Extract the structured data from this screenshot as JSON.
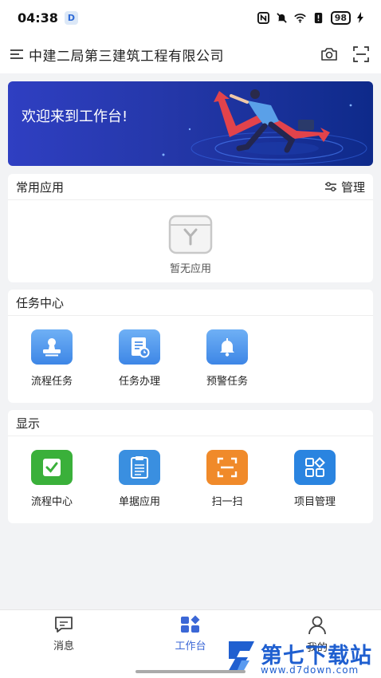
{
  "status_bar": {
    "time": "04:38",
    "app_badge": "D",
    "battery": "98"
  },
  "header": {
    "company_name": "中建二局第三建筑工程有限公司",
    "icons": [
      "menu-icon",
      "camera-icon",
      "scan-icon"
    ]
  },
  "banner": {
    "text": "欢迎来到工作台!"
  },
  "common_apps": {
    "title": "常用应用",
    "manage_label": "管理",
    "empty_text": "暂无应用"
  },
  "task_center": {
    "title": "任务中心",
    "items": [
      {
        "label": "流程任务",
        "icon": "stamp-icon",
        "color": "#4a8fe8"
      },
      {
        "label": "任务办理",
        "icon": "document-clock-icon",
        "color": "#4a8fe8"
      },
      {
        "label": "预警任务",
        "icon": "bell-icon",
        "color": "#4a8fe8"
      }
    ]
  },
  "display": {
    "title": "显示",
    "items": [
      {
        "label": "流程中心",
        "icon": "checkbox-icon",
        "color": "#3ab03a"
      },
      {
        "label": "单据应用",
        "icon": "clipboard-icon",
        "color": "#3a8fe0"
      },
      {
        "label": "扫一扫",
        "icon": "scan-icon",
        "color": "#f08a2a"
      },
      {
        "label": "项目管理",
        "icon": "apps-grid-icon",
        "color": "#2a84e0"
      }
    ]
  },
  "tab_bar": {
    "tabs": [
      {
        "label": "消息",
        "icon": "message-icon",
        "active": false
      },
      {
        "label": "工作台",
        "icon": "workbench-icon",
        "active": true
      },
      {
        "label": "我的",
        "icon": "user-icon",
        "active": false
      }
    ],
    "active_color": "#3b67d6"
  },
  "watermark": {
    "title": "第七下载站",
    "url": "www.d7down.com"
  }
}
